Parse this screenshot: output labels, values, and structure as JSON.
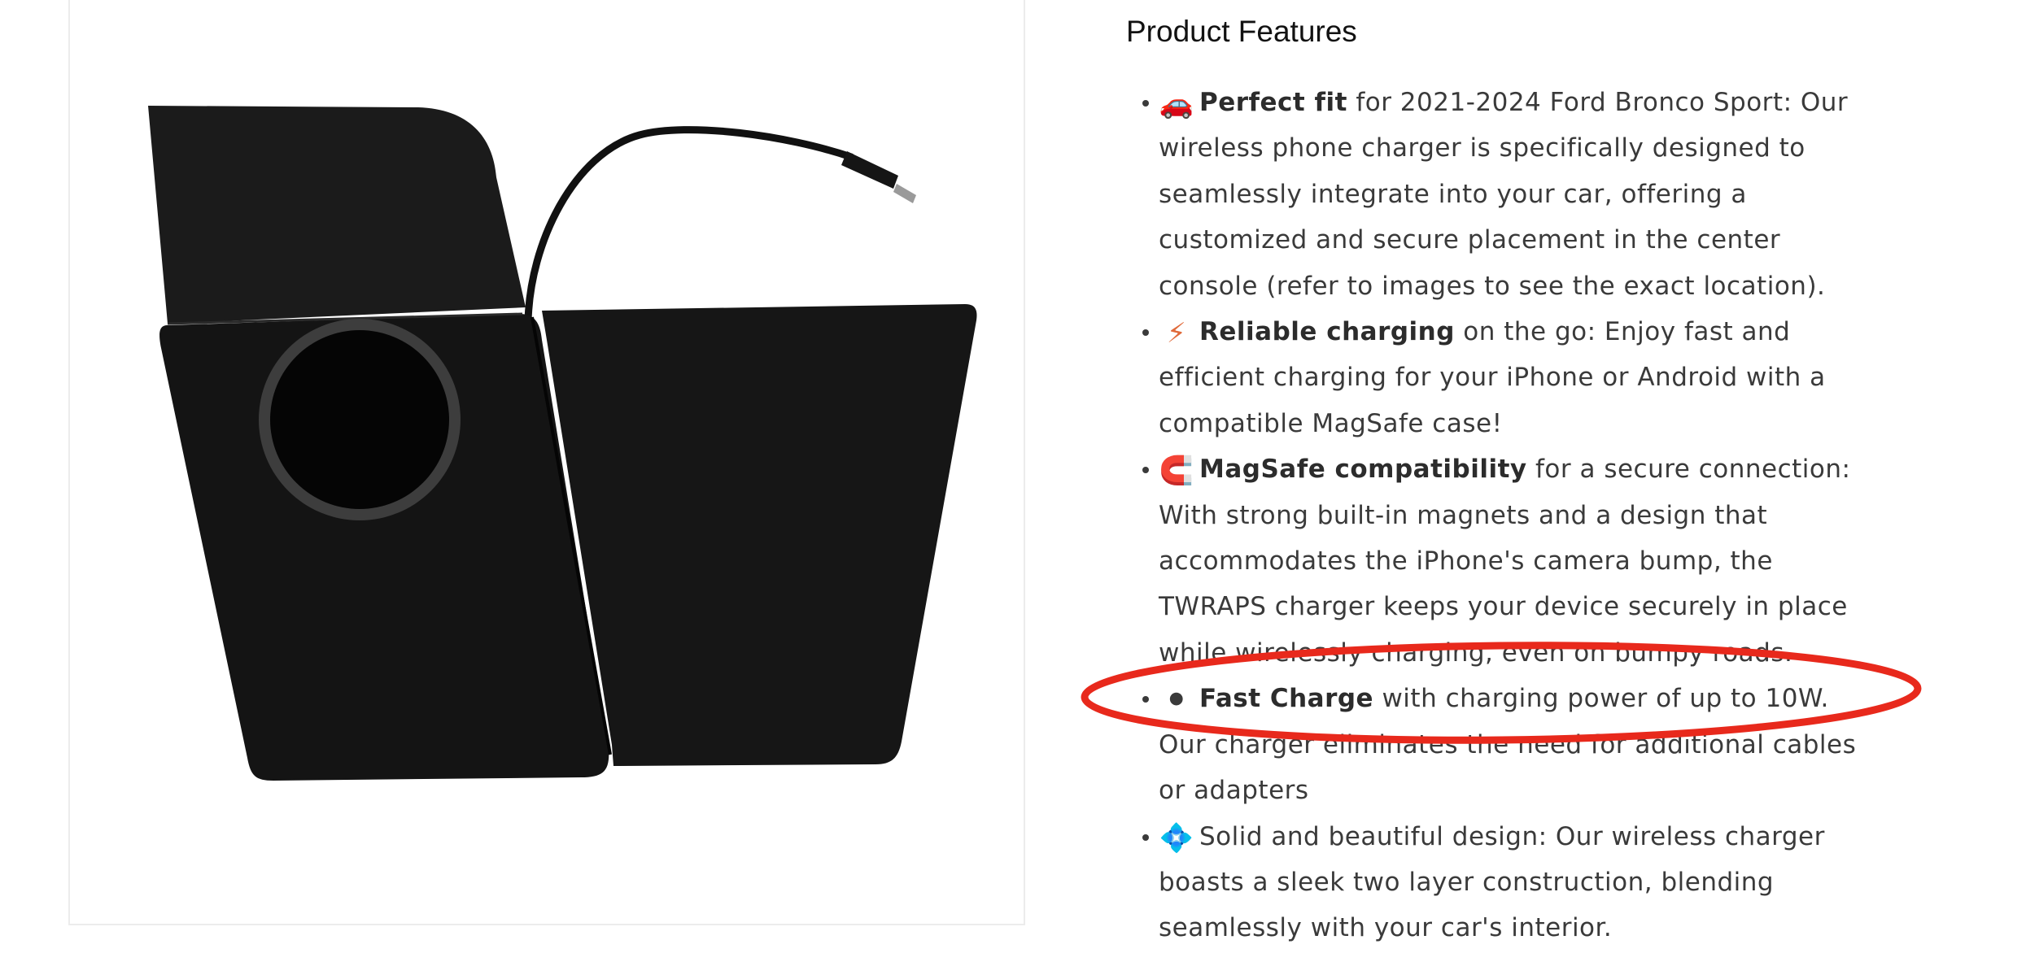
{
  "product_image": {
    "alt": "Black wireless phone charger console insert with circular MagSafe pad and USB-C cable"
  },
  "features": {
    "heading": "Product Features",
    "items": [
      {
        "emoji": "🚗",
        "bold": "Perfect fit",
        "text": " for 2021-2024 Ford Bronco Sport: Our wireless phone charger is specifically designed to seamlessly integrate into your car, offering a customized and secure placement in the center console (refer to images to see the exact location)."
      },
      {
        "emoji": "⚡",
        "bold": "Reliable charging",
        "text": " on the go: Enjoy fast and efficient charging for your iPhone or Android with a compatible MagSafe case!"
      },
      {
        "emoji": "🧲",
        "bold": "MagSafe compatibility",
        "text": " for a secure connection: With strong built-in magnets and a design that accommodates the iPhone's camera bump, the TWRAPS charger keeps your device securely in place while wirelessly charging, even on bumpy roads."
      },
      {
        "emoji": "⚫",
        "bold": "Fast Charge",
        "text": " with charging power of up to 10W. Our charger eliminates the need for additional cables or adapters"
      },
      {
        "emoji": "💠",
        "bold": "",
        "text": "Solid and beautiful design: Our wireless charger boasts a sleek two layer construction, blending seamlessly with your car's interior."
      }
    ]
  },
  "annotation": {
    "color": "#e8291c",
    "target": "Fast Charge"
  }
}
